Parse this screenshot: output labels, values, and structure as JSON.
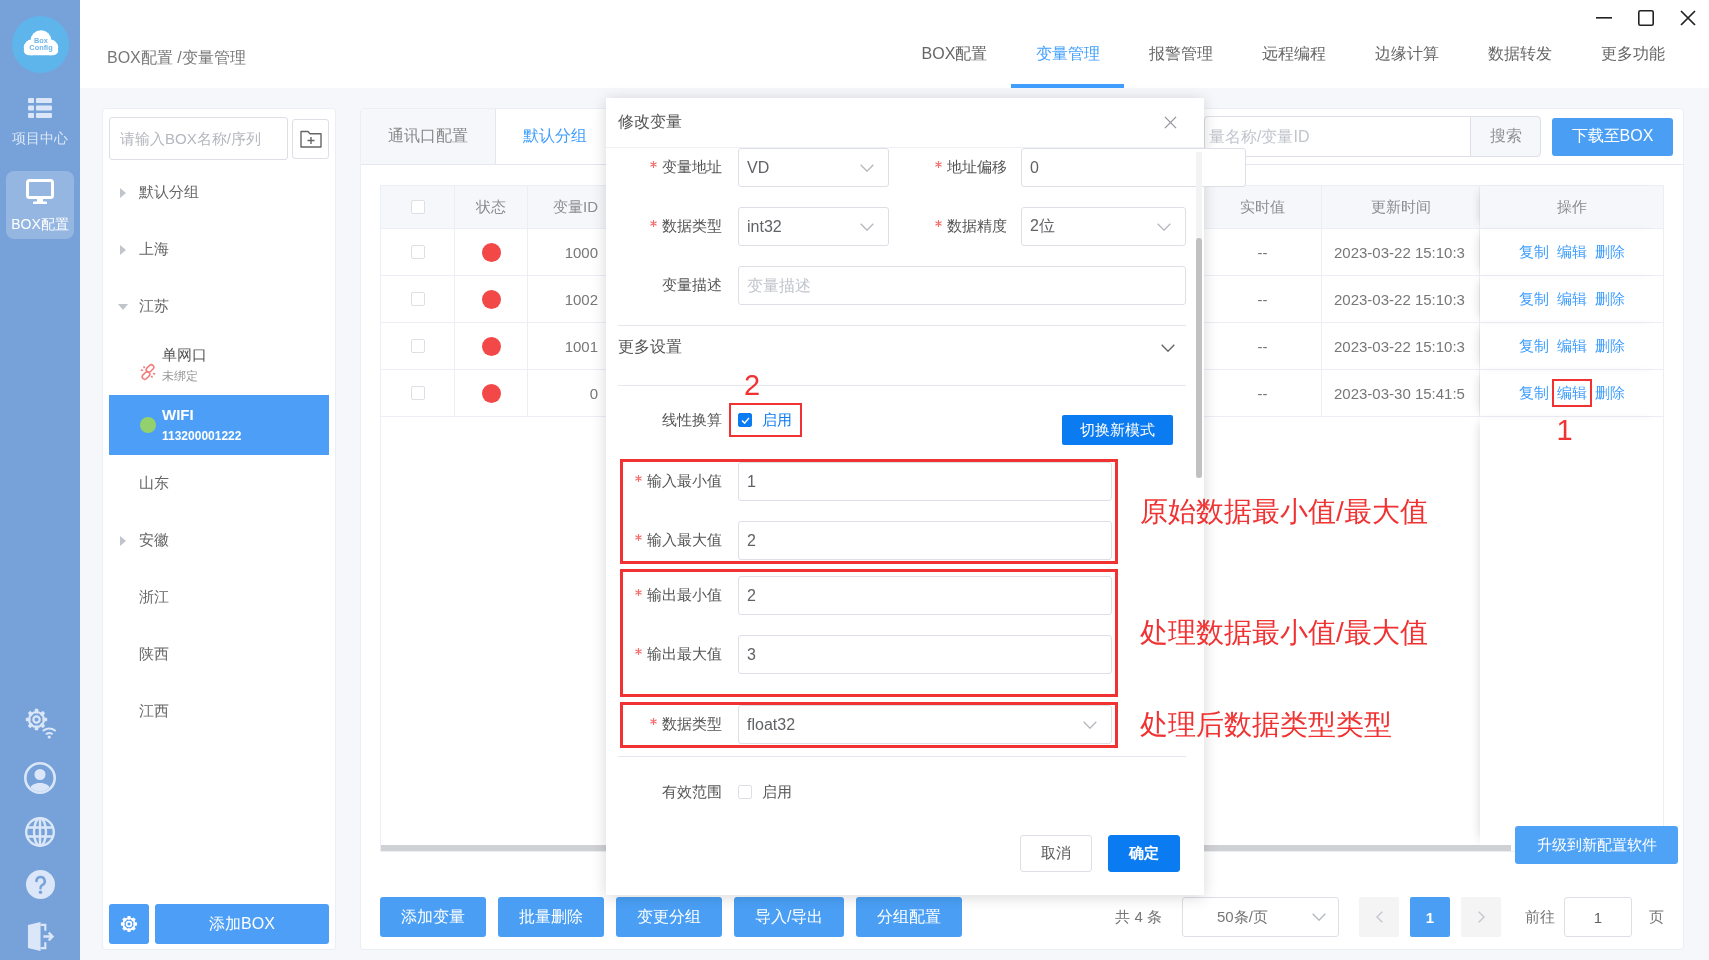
{
  "rail": {
    "logo_lines": [
      "Box",
      "Config"
    ],
    "items": [
      {
        "label": "项目中心",
        "selected": false
      },
      {
        "label": "BOX配置",
        "selected": true
      }
    ]
  },
  "header": {
    "breadcrumb": "BOX配置 /变量管理",
    "nav": [
      {
        "label": "BOX配置",
        "selected": false
      },
      {
        "label": "变量管理",
        "selected": true
      },
      {
        "label": "报警管理",
        "selected": false
      },
      {
        "label": "远程编程",
        "selected": false
      },
      {
        "label": "边缘计算",
        "selected": false
      },
      {
        "label": "数据转发",
        "selected": false
      },
      {
        "label": "更多功能",
        "selected": false
      }
    ]
  },
  "sidebar": {
    "search": {
      "placeholder": "请输入BOX名称/序列"
    },
    "tree": [
      {
        "label": "默认分组",
        "kind": "folder",
        "expanded": false,
        "selected": false
      },
      {
        "label": "上海",
        "kind": "folder",
        "expanded": false,
        "selected": false
      },
      {
        "label": "江苏",
        "kind": "folder",
        "expanded": true,
        "selected": false,
        "children": [
          {
            "label": "单网口",
            "subtitle": "未绑定",
            "kind": "unbound",
            "selected": false
          },
          {
            "label": "WIFI",
            "subtitle": "113200001222",
            "kind": "online",
            "selected": true
          }
        ]
      },
      {
        "label": "山东",
        "kind": "leaf",
        "selected": false
      },
      {
        "label": "安徽",
        "kind": "folder",
        "expanded": false,
        "selected": false
      },
      {
        "label": "浙江",
        "kind": "leaf",
        "selected": false
      },
      {
        "label": "陕西",
        "kind": "leaf",
        "selected": false
      },
      {
        "label": "江西",
        "kind": "leaf",
        "selected": false
      }
    ],
    "add_button": "添加BOX"
  },
  "tabs": [
    {
      "label": "通讯口配置",
      "selected": false
    },
    {
      "label": "默认分组",
      "selected": true
    }
  ],
  "search": {
    "placeholder": "量名称/变量ID",
    "button": "搜索"
  },
  "download_button": "下载至BOX",
  "table": {
    "header_checked": false,
    "columns": [
      "状态",
      "变量ID",
      "实时值",
      "更新时间",
      "操作"
    ],
    "rows": [
      {
        "checked": false,
        "color": "#f24848",
        "id": "1000",
        "value": "--",
        "time": "2023-03-22 15:10:3",
        "actions": [
          {
            "label": "复制",
            "highlighted": false
          },
          {
            "label": "编辑",
            "highlighted": false
          },
          {
            "label": "删除",
            "highlighted": false
          }
        ]
      },
      {
        "checked": false,
        "color": "#f24848",
        "id": "1002",
        "value": "--",
        "time": "2023-03-22 15:10:3",
        "actions": [
          {
            "label": "复制",
            "highlighted": false
          },
          {
            "label": "编辑",
            "highlighted": false
          },
          {
            "label": "删除",
            "highlighted": false
          }
        ]
      },
      {
        "checked": false,
        "color": "#f24848",
        "id": "1001",
        "value": "--",
        "time": "2023-03-22 15:10:3",
        "actions": [
          {
            "label": "复制",
            "highlighted": false
          },
          {
            "label": "编辑",
            "highlighted": false
          },
          {
            "label": "删除",
            "highlighted": false
          }
        ]
      },
      {
        "checked": false,
        "color": "#f24848",
        "id": "0",
        "value": "--",
        "time": "2023-03-30 15:41:5",
        "actions": [
          {
            "label": "复制",
            "highlighted": false
          },
          {
            "label": "编辑",
            "highlighted": true,
            "marker": "1"
          },
          {
            "label": "删除",
            "highlighted": false
          }
        ]
      }
    ]
  },
  "upgrade_button": "升级到新配置软件",
  "toolbar": [
    "添加变量",
    "批量删除",
    "变更分组",
    "导入/导出",
    "分组配置"
  ],
  "pagination": {
    "total": "共 4 条",
    "page_size": "50条/页",
    "pages": [
      {
        "label": "1",
        "selected": true
      }
    ],
    "goto_label": "前往",
    "goto_value": "1",
    "goto_suffix": "页"
  },
  "dialog": {
    "title": "修改变量",
    "rows": [
      [
        {
          "kind": "select",
          "label": "变量地址",
          "required": true,
          "value": "VD"
        },
        {
          "kind": "input",
          "label": "地址偏移",
          "required": true,
          "value": "0"
        }
      ],
      [
        {
          "kind": "select",
          "label": "数据类型",
          "required": true,
          "value": "int32"
        },
        {
          "kind": "select",
          "label": "数据精度",
          "required": true,
          "value": "2位"
        }
      ],
      [
        {
          "kind": "input",
          "label": "变量描述",
          "required": false,
          "placeholder": "变量描述"
        }
      ]
    ],
    "more_settings": {
      "label": "更多设置",
      "expanded": true
    },
    "linear": {
      "label": "线性换算",
      "option": "启用",
      "checked": true,
      "highlighted": true,
      "marker": "2",
      "mode_button": "切换新模式"
    },
    "groups": [
      {
        "highlighted": true,
        "note": "原始数据最小值/最大值",
        "fields": [
          {
            "kind": "input",
            "label": "输入最小值",
            "required": true,
            "value": "1"
          },
          {
            "kind": "input",
            "label": "输入最大值",
            "required": true,
            "value": "2"
          }
        ]
      },
      {
        "highlighted": true,
        "note": "处理数据最小值/最大值",
        "fields": [
          {
            "kind": "input",
            "label": "输出最小值",
            "required": true,
            "value": "2"
          },
          {
            "kind": "input",
            "label": "输出最大值",
            "required": true,
            "value": "3"
          }
        ]
      },
      {
        "highlighted": true,
        "note": "处理后数据类型类型",
        "fields": [
          {
            "kind": "select",
            "label": "数据类型",
            "required": true,
            "value": "float32"
          }
        ]
      }
    ],
    "valid_range": {
      "label": "有效范围",
      "option": "启用",
      "checked": false
    },
    "buttons": [
      {
        "label": "取消",
        "kind": "default"
      },
      {
        "label": "确定",
        "kind": "primary"
      }
    ]
  }
}
